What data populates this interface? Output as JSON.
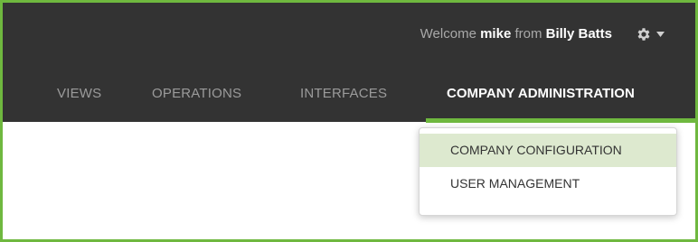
{
  "header": {
    "welcome_prefix": "Welcome",
    "user": "mike",
    "welcome_middle": "from",
    "company": "Billy Batts",
    "settings_icon": "gear-icon",
    "dropdown_caret_icon": "caret-down-icon"
  },
  "nav": {
    "items": [
      {
        "label": "VIEWS"
      },
      {
        "label": "OPERATIONS"
      },
      {
        "label": "INTERFACES"
      },
      {
        "label": "COMPANY ADMINISTRATION"
      }
    ],
    "active_index": 3
  },
  "dropdown": {
    "items": [
      {
        "label": "COMPANY CONFIGURATION",
        "highlighted": true
      },
      {
        "label": "USER MANAGEMENT",
        "highlighted": false
      }
    ]
  },
  "colors": {
    "accent": "#6fb83f",
    "header_bg": "#333333",
    "highlight_bg": "#dde9cf"
  }
}
